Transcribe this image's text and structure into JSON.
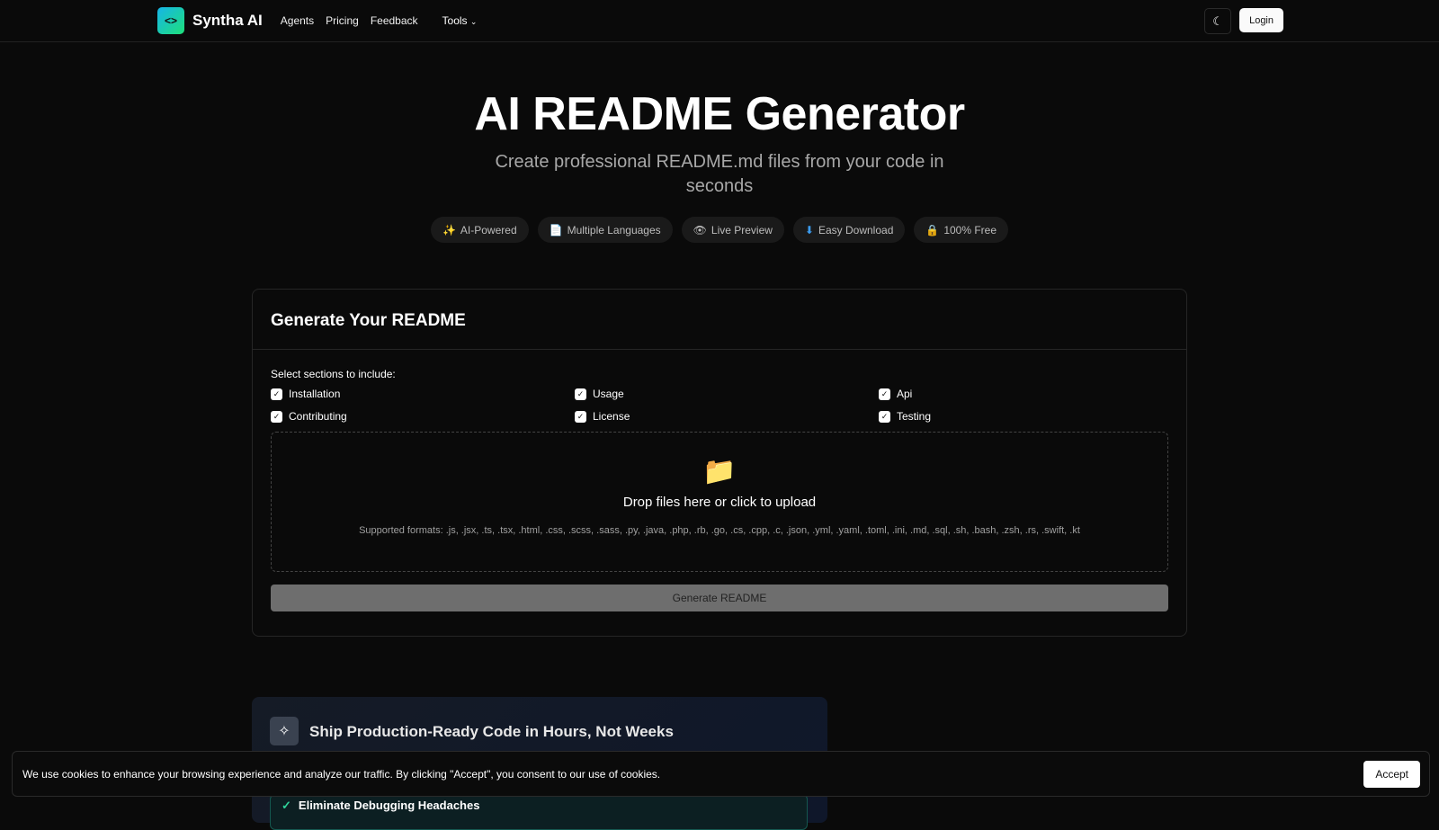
{
  "nav": {
    "brand": "Syntha AI",
    "links": [
      "Agents",
      "Pricing",
      "Feedback"
    ],
    "tools": "Tools",
    "login": "Login"
  },
  "hero": {
    "title": "AI README Generator",
    "subtitle": "Create professional README.md files from your code in seconds",
    "pills": [
      {
        "icon": "✨",
        "label": "AI-Powered"
      },
      {
        "icon": "📄",
        "label": "Multiple Languages"
      },
      {
        "icon": "👁",
        "label": "Live Preview"
      },
      {
        "icon": "⬇",
        "label": "Easy Download"
      },
      {
        "icon": "🔒",
        "label": "100% Free"
      }
    ]
  },
  "form": {
    "title": "Generate Your README",
    "sections_label": "Select sections to include:",
    "sections": [
      {
        "label": "Installation",
        "checked": true
      },
      {
        "label": "Usage",
        "checked": true
      },
      {
        "label": "Api",
        "checked": true
      },
      {
        "label": "Contributing",
        "checked": true
      },
      {
        "label": "License",
        "checked": true
      },
      {
        "label": "Testing",
        "checked": true
      }
    ],
    "drop_text": "Drop files here or click to upload",
    "formats": "Supported formats: .js, .jsx, .ts, .tsx, .html, .css, .scss, .sass, .py, .java, .php, .rb, .go, .cs, .cpp, .c, .json, .yml, .yaml, .toml, .ini, .md, .sql, .sh, .bash, .zsh, .rs, .swift, .kt",
    "generate": "Generate README"
  },
  "promo": {
    "title": "Ship Production-Ready Code in Hours, Not Weeks",
    "item": "Eliminate Debugging Headaches"
  },
  "cookie": {
    "text": "We use cookies to enhance your browsing experience and analyze our traffic. By clicking \"Accept\", you consent to our use of cookies.",
    "accept": "Accept"
  }
}
